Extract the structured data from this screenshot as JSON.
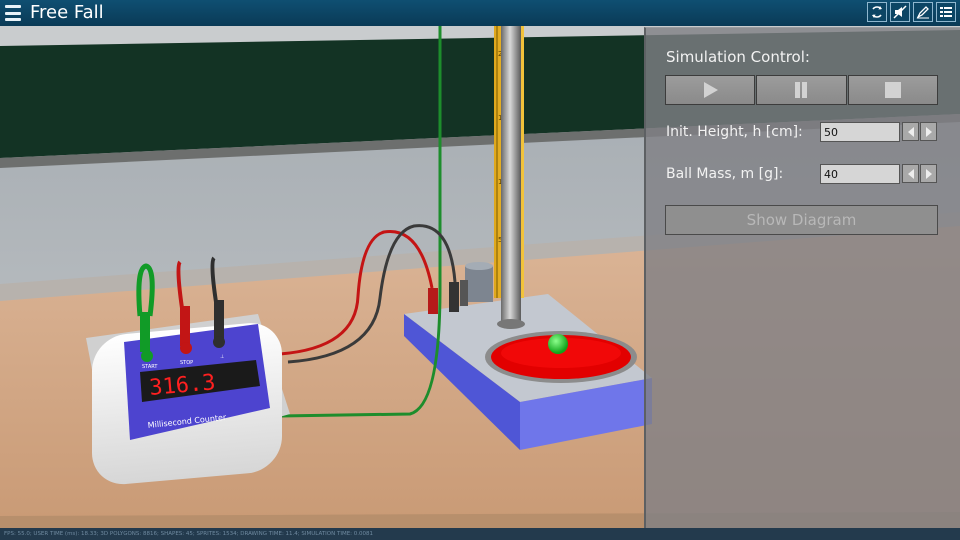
{
  "app": {
    "title": "Free Fall"
  },
  "toolbar": {
    "icons": [
      "reset-icon",
      "mute-icon",
      "draw-icon",
      "settings-icon"
    ]
  },
  "counter": {
    "display": "316.3",
    "label": "Millisecond Counter",
    "terminals": [
      "START",
      "STOP",
      "⊥"
    ]
  },
  "ruler": {
    "ticks": [
      "20",
      "15",
      "10",
      "5"
    ]
  },
  "panel": {
    "title": "Simulation Control:",
    "controls": [
      "play-icon",
      "pause-icon",
      "stop-icon"
    ],
    "height": {
      "label": "Init. Height, h [cm]:",
      "value": "50"
    },
    "mass": {
      "label": "Ball Mass, m [g]:",
      "value": "40"
    },
    "diagram_button": "Show Diagram"
  },
  "status": {
    "text": "FPS: 55.0; USER TIME (ms): 18.33; 3D POLYGONS: 8816; SHAPES: 45; SPRITES: 1534; DRAWING TIME: 11.4; SIMULATION TIME: 0.0081"
  },
  "colors": {
    "titlebar": "#0b4566",
    "board": "#143323",
    "table": "#d6a884",
    "counter_panel": "#4d44cf",
    "plate": "#e00000",
    "ball": "#1fcc2a"
  }
}
